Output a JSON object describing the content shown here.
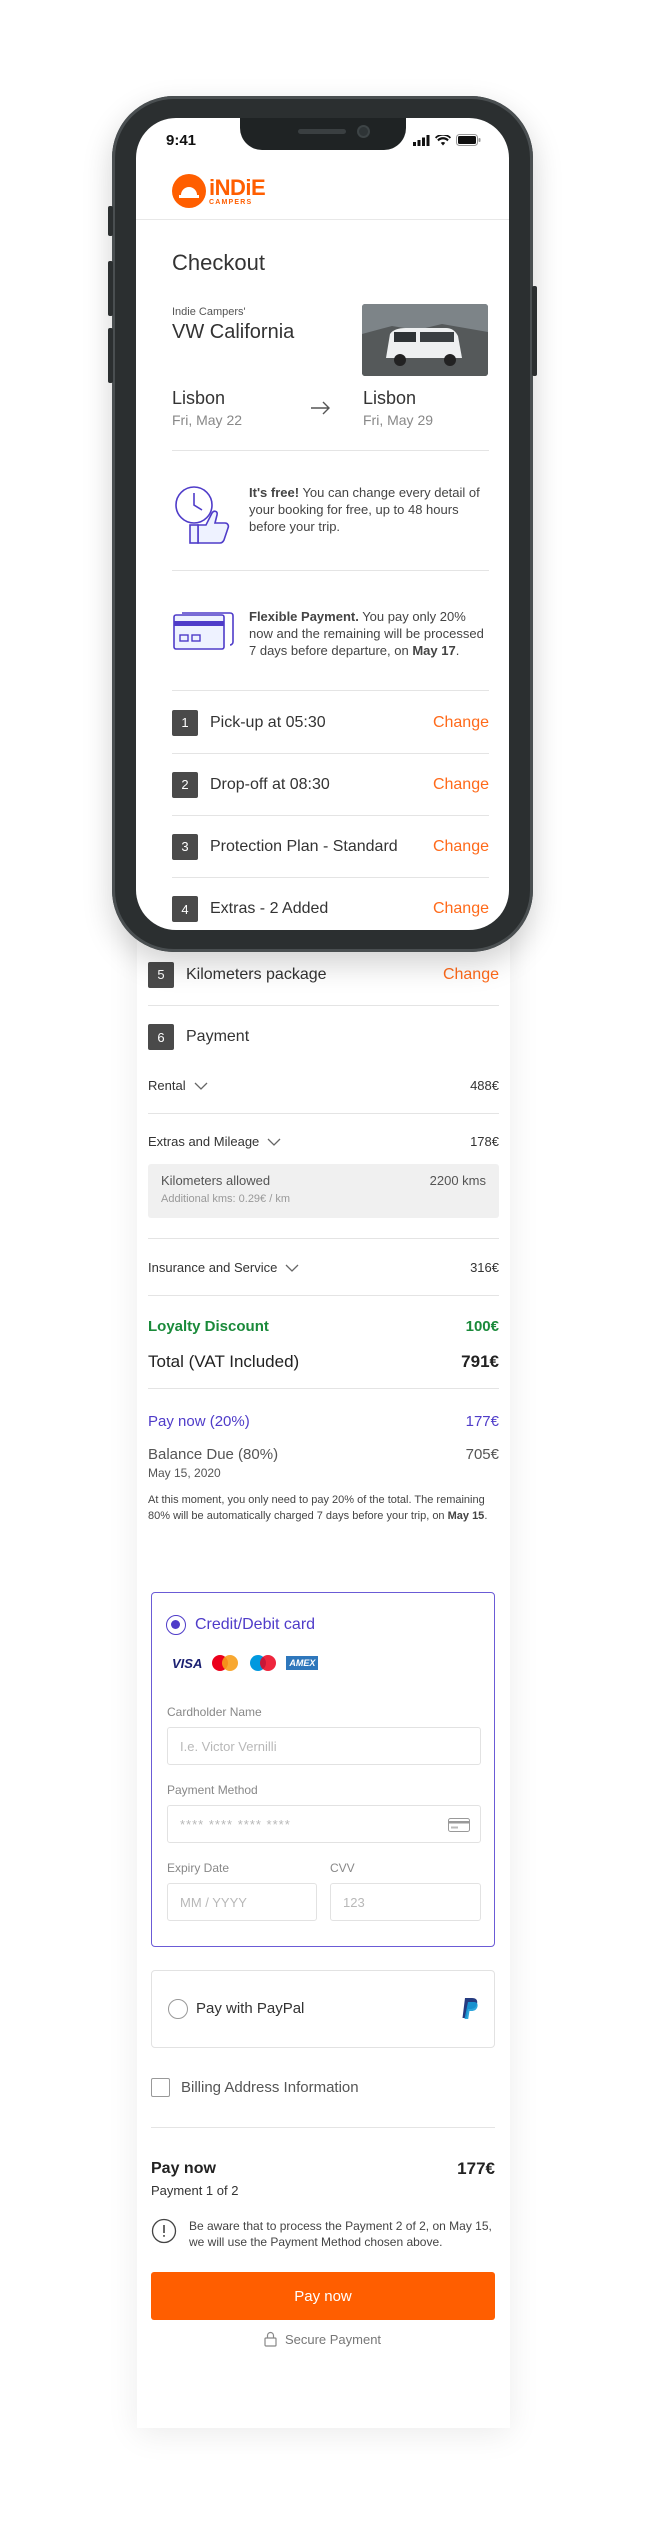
{
  "status": {
    "time": "9:41"
  },
  "brand": {
    "name": "iNDiE",
    "sub": "CAMPERS"
  },
  "page_title": "Checkout",
  "vehicle": {
    "brand_line": "Indie Campers'",
    "model": "VW California"
  },
  "route": {
    "from_city": "Lisbon",
    "from_date": "Fri, May 22",
    "to_city": "Lisbon",
    "to_date": "Fri, May 29"
  },
  "info_free": {
    "bold": "It's free!",
    "text": " You can change every detail of your booking for free, up to 48 hours before your trip."
  },
  "info_flex": {
    "bold": "Flexible Payment.",
    "text": " You pay only 20% now and the remaining will be processed 7 days before departure, on ",
    "date": "May 17",
    "end": "."
  },
  "steps": [
    {
      "num": "1",
      "label": "Pick-up at 05:30",
      "action": "Change"
    },
    {
      "num": "2",
      "label": "Drop-off at 08:30",
      "action": "Change"
    },
    {
      "num": "3",
      "label": "Protection Plan - Standard",
      "action": "Change"
    },
    {
      "num": "4",
      "label": "Extras - 2 Added",
      "action": "Change"
    },
    {
      "num": "5",
      "label": "Kilometers package",
      "action": "Change"
    },
    {
      "num": "6",
      "label": "Payment",
      "action": ""
    }
  ],
  "summary": {
    "rental_label": "Rental",
    "rental_value": "488€",
    "extras_label": "Extras and Mileage",
    "extras_value": "178€",
    "km_label": "Kilometers allowed",
    "km_value": "2200 kms",
    "km_note": "Additional kms: 0.29€ / km",
    "insurance_label": "Insurance and Service",
    "insurance_value": "316€",
    "loyalty_label": "Loyalty Discount",
    "loyalty_value": "100€",
    "total_label": "Total (VAT Included)",
    "total_value": "791€",
    "paynow_label": "Pay now (20%)",
    "paynow_value": "177€",
    "balance_label": "Balance Due (80%)",
    "balance_value": "705€",
    "balance_date": "May 15, 2020",
    "note_text": "At this moment, you only need to pay 20% of the total. The remaining 80% will be automatically charged 7 days before your trip, on ",
    "note_date": "May 15",
    "note_end": "."
  },
  "card_form": {
    "title": "Credit/Debit card",
    "brands": [
      "VISA",
      "mastercard",
      "maestro",
      "AMEX"
    ],
    "name_label": "Cardholder Name",
    "name_placeholder": "I.e. Victor Vernilli",
    "method_label": "Payment Method",
    "method_placeholder": "**** **** **** ****",
    "expiry_label": "Expiry Date",
    "expiry_placeholder": "MM / YYYY",
    "cvv_label": "CVV",
    "cvv_placeholder": "123"
  },
  "paypal": {
    "label": "Pay with PayPal"
  },
  "billing": {
    "label": "Billing Address Information"
  },
  "footer": {
    "paynow_title": "Pay now",
    "paynow_sub": "Payment 1 of 2",
    "paynow_amount": "177€",
    "notice": "Be aware that to process the Payment 2 of 2, on May 15, we will use the Payment Method chosen above.",
    "button": "Pay now",
    "secure": "Secure Payment"
  },
  "colors": {
    "accent": "#ff5e00",
    "purple": "#4f3cc9",
    "green": "#1a8a3a"
  }
}
